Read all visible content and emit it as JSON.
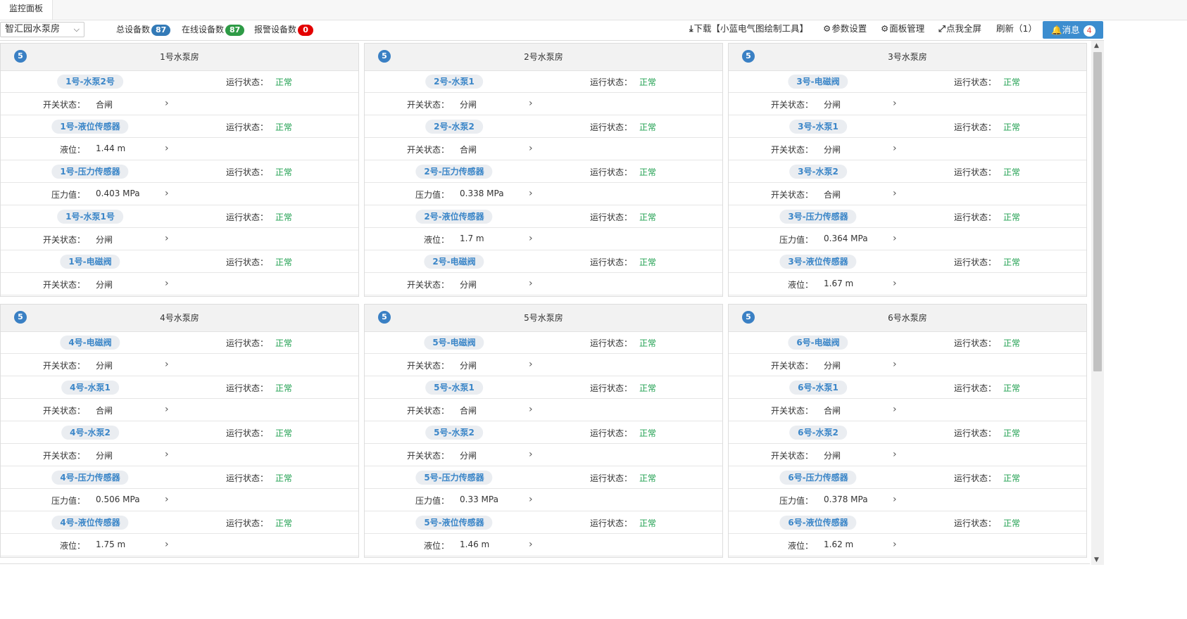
{
  "tab": {
    "label": "监控面板"
  },
  "toolbar": {
    "select_value": "智汇园水泵房",
    "stats": [
      {
        "label": "总设备数",
        "count": "87",
        "color": "blue"
      },
      {
        "label": "在线设备数",
        "count": "87",
        "color": "green"
      },
      {
        "label": "报警设备数",
        "count": "0",
        "color": "red"
      }
    ],
    "download": "下载【小蓝电气图绘制工具】",
    "params": "参数设置",
    "panel_manage": "面板管理",
    "fullscreen": "点我全屏",
    "refresh": "刷新（1）",
    "message": "消息",
    "message_count": "4"
  },
  "panels": [
    {
      "badge": "5",
      "title": "1号水泵房",
      "devices": [
        {
          "name": "1号-水泵2号",
          "status_label": "运行状态：",
          "status": "正常",
          "key": "开关状态：",
          "value": "合闸"
        },
        {
          "name": "1号-液位传感器",
          "status_label": "运行状态：",
          "status": "正常",
          "key": "液位：",
          "value": "1.44 m"
        },
        {
          "name": "1号-压力传感器",
          "status_label": "运行状态：",
          "status": "正常",
          "key": "压力值：",
          "value": "0.403 MPa"
        },
        {
          "name": "1号-水泵1号",
          "status_label": "运行状态：",
          "status": "正常",
          "key": "开关状态：",
          "value": "分闸"
        },
        {
          "name": "1号-电磁阀",
          "status_label": "运行状态：",
          "status": "正常",
          "key": "开关状态：",
          "value": "分闸"
        }
      ]
    },
    {
      "badge": "5",
      "title": "2号水泵房",
      "devices": [
        {
          "name": "2号-水泵1",
          "status_label": "运行状态：",
          "status": "正常",
          "key": "开关状态：",
          "value": "分闸"
        },
        {
          "name": "2号-水泵2",
          "status_label": "运行状态：",
          "status": "正常",
          "key": "开关状态：",
          "value": "合闸"
        },
        {
          "name": "2号-压力传感器",
          "status_label": "运行状态：",
          "status": "正常",
          "key": "压力值：",
          "value": "0.338 MPa"
        },
        {
          "name": "2号-液位传感器",
          "status_label": "运行状态：",
          "status": "正常",
          "key": "液位：",
          "value": "1.7 m"
        },
        {
          "name": "2号-电磁阀",
          "status_label": "运行状态：",
          "status": "正常",
          "key": "开关状态：",
          "value": "分闸"
        }
      ]
    },
    {
      "badge": "5",
      "title": "3号水泵房",
      "devices": [
        {
          "name": "3号-电磁阀",
          "status_label": "运行状态：",
          "status": "正常",
          "key": "开关状态：",
          "value": "分闸"
        },
        {
          "name": "3号-水泵1",
          "status_label": "运行状态：",
          "status": "正常",
          "key": "开关状态：",
          "value": "分闸"
        },
        {
          "name": "3号-水泵2",
          "status_label": "运行状态：",
          "status": "正常",
          "key": "开关状态：",
          "value": "合闸"
        },
        {
          "name": "3号-压力传感器",
          "status_label": "运行状态：",
          "status": "正常",
          "key": "压力值：",
          "value": "0.364 MPa"
        },
        {
          "name": "3号-液位传感器",
          "status_label": "运行状态：",
          "status": "正常",
          "key": "液位：",
          "value": "1.67 m"
        }
      ]
    },
    {
      "badge": "5",
      "title": "4号水泵房",
      "devices": [
        {
          "name": "4号-电磁阀",
          "status_label": "运行状态：",
          "status": "正常",
          "key": "开关状态：",
          "value": "分闸"
        },
        {
          "name": "4号-水泵1",
          "status_label": "运行状态：",
          "status": "正常",
          "key": "开关状态：",
          "value": "合闸"
        },
        {
          "name": "4号-水泵2",
          "status_label": "运行状态：",
          "status": "正常",
          "key": "开关状态：",
          "value": "分闸"
        },
        {
          "name": "4号-压力传感器",
          "status_label": "运行状态：",
          "status": "正常",
          "key": "压力值：",
          "value": "0.506 MPa"
        },
        {
          "name": "4号-液位传感器",
          "status_label": "运行状态：",
          "status": "正常",
          "key": "液位：",
          "value": "1.75 m"
        }
      ]
    },
    {
      "badge": "5",
      "title": "5号水泵房",
      "devices": [
        {
          "name": "5号-电磁阀",
          "status_label": "运行状态：",
          "status": "正常",
          "key": "开关状态：",
          "value": "分闸"
        },
        {
          "name": "5号-水泵1",
          "status_label": "运行状态：",
          "status": "正常",
          "key": "开关状态：",
          "value": "合闸"
        },
        {
          "name": "5号-水泵2",
          "status_label": "运行状态：",
          "status": "正常",
          "key": "开关状态：",
          "value": "分闸"
        },
        {
          "name": "5号-压力传感器",
          "status_label": "运行状态：",
          "status": "正常",
          "key": "压力值：",
          "value": "0.33 MPa"
        },
        {
          "name": "5号-液位传感器",
          "status_label": "运行状态：",
          "status": "正常",
          "key": "液位：",
          "value": "1.46 m"
        }
      ]
    },
    {
      "badge": "5",
      "title": "6号水泵房",
      "devices": [
        {
          "name": "6号-电磁阀",
          "status_label": "运行状态：",
          "status": "正常",
          "key": "开关状态：",
          "value": "分闸"
        },
        {
          "name": "6号-水泵1",
          "status_label": "运行状态：",
          "status": "正常",
          "key": "开关状态：",
          "value": "合闸"
        },
        {
          "name": "6号-水泵2",
          "status_label": "运行状态：",
          "status": "正常",
          "key": "开关状态：",
          "value": "分闸"
        },
        {
          "name": "6号-压力传感器",
          "status_label": "运行状态：",
          "status": "正常",
          "key": "压力值：",
          "value": "0.378 MPa"
        },
        {
          "name": "6号-液位传感器",
          "status_label": "运行状态：",
          "status": "正常",
          "key": "液位：",
          "value": "1.62 m"
        }
      ]
    }
  ]
}
